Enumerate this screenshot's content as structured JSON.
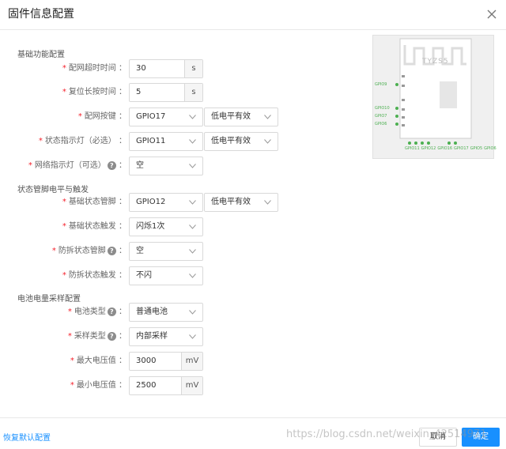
{
  "dialog": {
    "title": "固件信息配置"
  },
  "sections": {
    "basic": "基础功能配置",
    "status_pin": "状态管脚电平与触发",
    "battery": "电池电量采样配置"
  },
  "fields": {
    "network_timeout": {
      "label": "配网超时时间",
      "value": "30",
      "unit": "s"
    },
    "reset_press": {
      "label": "复位长按时间",
      "value": "5",
      "unit": "s"
    },
    "network_key": {
      "label": "配网按键",
      "pin": "GPIO17",
      "level": "低电平有效"
    },
    "status_led": {
      "label": "状态指示灯（必选）",
      "pin": "GPIO11",
      "level": "低电平有效"
    },
    "network_led": {
      "label": "网络指示灯（可选）",
      "pin": "空"
    },
    "basic_pin": {
      "label": "基础状态管脚",
      "pin": "GPIO12",
      "level": "低电平有效"
    },
    "basic_trigger": {
      "label": "基础状态触发",
      "value": "闪烁1次"
    },
    "tamper_pin": {
      "label": "防拆状态管脚",
      "value": "空"
    },
    "tamper_trigger": {
      "label": "防拆状态触发",
      "value": "不闪"
    },
    "battery_type": {
      "label": "电池类型",
      "value": "普通电池"
    },
    "sampling_type": {
      "label": "采样类型",
      "value": "内部采样"
    },
    "max_voltage": {
      "label": "最大电压值",
      "value": "3000",
      "unit": "mV"
    },
    "min_voltage": {
      "label": "最小电压值",
      "value": "2500",
      "unit": "mV"
    }
  },
  "chip": {
    "model": "TYZS5",
    "left_pins": [
      "GPIO9",
      "GPIO10",
      "GPIO7",
      "GPIO6"
    ],
    "bottom_pins": [
      "GPIO11",
      "GPIO12",
      "GPIO16",
      "GPIO17",
      "GPIO5",
      "GPIO6"
    ]
  },
  "footer": {
    "reset_link": "恢复默认配置",
    "cancel": "取消",
    "confirm": "确定"
  },
  "watermark": "https://blog.csdn.net/weixin_42514971",
  "colors": {
    "primary": "#1890ff",
    "required": "#f5222d"
  }
}
